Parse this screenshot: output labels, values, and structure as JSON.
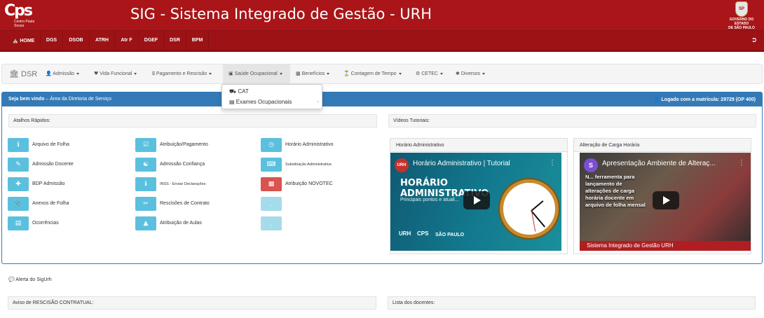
{
  "header": {
    "logo_text": "Cps",
    "logo_subtext": "Centro Paula Souza",
    "title": "SIG - Sistema Integrado de Gestão - URH",
    "gov_line1": "GOVERNO DO ESTADO",
    "gov_line2": "DE SÃO PAULO",
    "gov_seal": "SP"
  },
  "topnav": {
    "items": [
      "HOME",
      "DGS",
      "DSOB",
      "ATRH",
      "Atr F",
      "DGEF",
      "DSR",
      "BPM"
    ]
  },
  "menubar": {
    "brand": "DSR",
    "items": [
      "Admissão",
      "Vida Funcional",
      "$ Pagamento e Rescisão",
      "Saúde Ocupacional",
      "Benefícios",
      "Contagem de Tempo",
      "CETEC",
      "Diversos"
    ]
  },
  "dropdown": {
    "items": [
      "CAT",
      "Exames Ocupacionais"
    ]
  },
  "panel": {
    "welcome_bold": "Seja bem vindo",
    "welcome_rest": " – Área da Diretoria de Serviço",
    "logged": "Logado com a matrícula: 29729 (OP 400)"
  },
  "atalhos": {
    "title": "Atalhos Rápidos:",
    "col1": [
      "Arquivo de Folha",
      "Admissão Docente",
      "BDP Admissão",
      "Anexos de Folha",
      "Ocorrências"
    ],
    "col2": [
      "Atribuição/Pagamento",
      "Admissão Confiança",
      "INSS - Enviar Declarações",
      "Rescisões de Contrato",
      "Atribuição de Aulas"
    ],
    "col3": [
      "Horário Administrativo",
      "Substituição Administrativa",
      "Atribuição NOVOTEC"
    ]
  },
  "videos": {
    "title": "Vídeos Tutoriais:",
    "v1": {
      "header": "Horário Administrativo",
      "yt_title": "Horário Administrativo | Tutorial",
      "channel": "URH",
      "big1": "HORÁRIO",
      "big2": "ADMINISTRATIVO",
      "subtitle": "Principais pontos e atuali...",
      "brand1": "URH",
      "brand2": "CPS",
      "brand3": "SÃO PAULO"
    },
    "v2": {
      "header": "Alteração de Carga Horária",
      "yt_title": "Apresentação Ambiente de Alteraç...",
      "channel": "S",
      "line1": "N... ferramenta para",
      "line2": "lançamento de",
      "line3": "alterações de carga",
      "line4": "horária docente em",
      "line5": "arquivo de folha mensal",
      "strip": "Sistema Integrado de Gestão URH"
    }
  },
  "footer": {
    "alert": "Alerta do SigUrh",
    "aviso": "Aviso de RESCISÃO CONTRATUAL:",
    "lista": "Lista dos docentes:"
  },
  "colors": {
    "brand_red": "#a91518",
    "panel_blue": "#337ab7",
    "info_btn": "#5bc0de",
    "danger_btn": "#d9534f"
  }
}
